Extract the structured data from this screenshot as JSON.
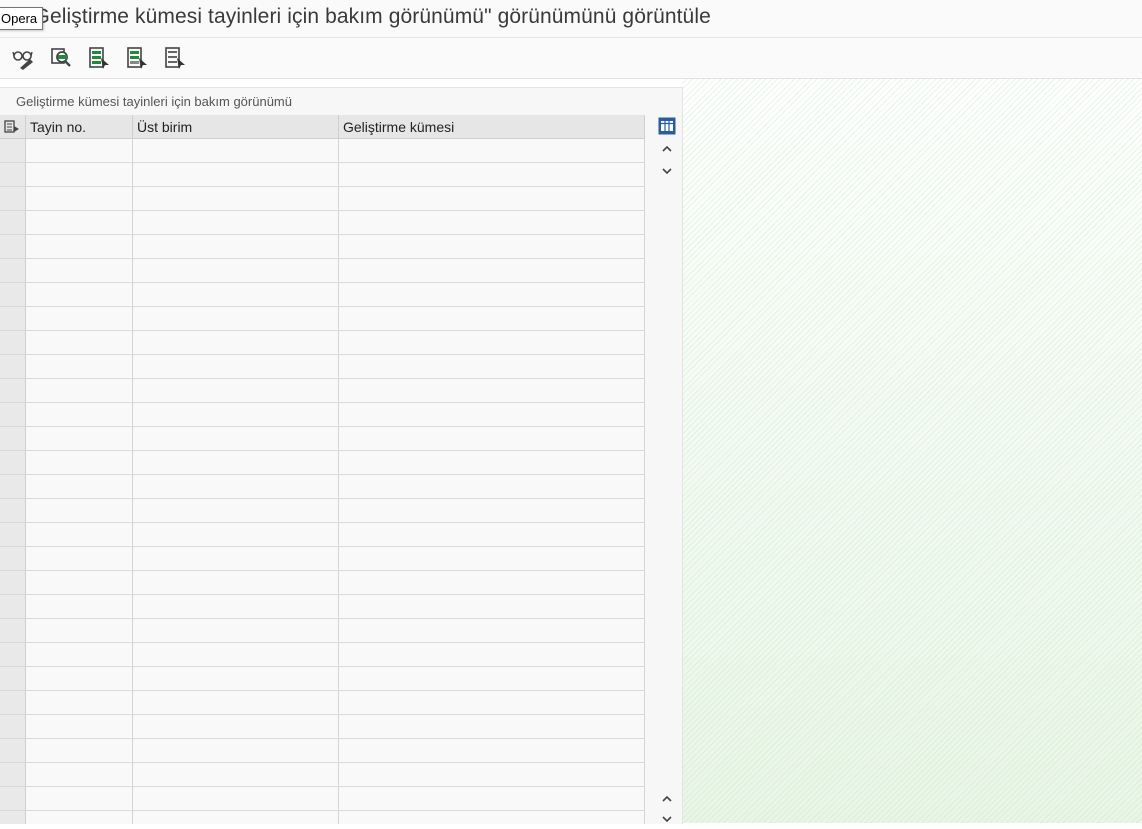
{
  "window": {
    "title": "\"Geliştirme kümesi tayinleri için bakım görünümü\" görünümünü görüntüle",
    "tooltip": "Opera"
  },
  "toolbar": {
    "buttons": [
      {
        "name": "display-change-icon"
      },
      {
        "name": "find-icon"
      },
      {
        "name": "select-all-icon"
      },
      {
        "name": "select-block-icon"
      },
      {
        "name": "deselect-all-icon"
      }
    ]
  },
  "table": {
    "caption": "Geliştirme kümesi tayinleri için bakım görünümü",
    "columns": [
      "Tayin no.",
      "Üst birim",
      "Geliştirme kümesi"
    ],
    "rows": []
  },
  "colors": {
    "accent_green": "#1f8a3c",
    "icon_gray": "#444444"
  }
}
